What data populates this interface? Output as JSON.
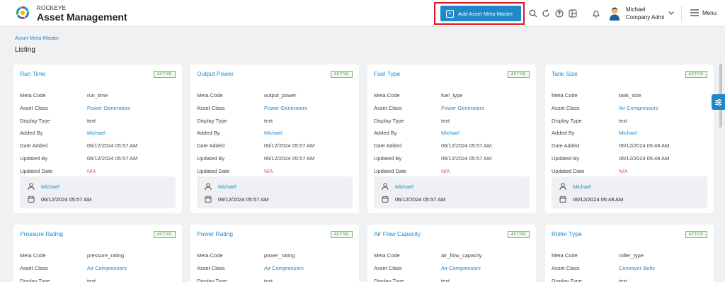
{
  "header": {
    "brand_small": "ROCKEYE",
    "brand_big": "Asset Management",
    "add_button_label": "Add Asset Meta Master",
    "user_name": "Michael",
    "user_role": "Company Admi",
    "menu_label": "Menu"
  },
  "breadcrumb": "Asset Meta Master",
  "page_title": "Listing",
  "field_labels": {
    "meta_code": "Meta Code",
    "asset_class": "Asset Class",
    "display_type": "Display Type",
    "added_by": "Added By",
    "date_added": "Date Added",
    "updated_by": "Updated By",
    "updated_date": "Updated Date"
  },
  "cards": [
    {
      "title": "Run Time",
      "status": "ACTIVE",
      "meta_code": "run_time",
      "asset_class": "Power Generators",
      "display_type": "text",
      "added_by": "Michael",
      "date_added": "06/12/2024 05:57 AM",
      "updated_by": "06/12/2024 05:57 AM",
      "updated_date": "N/A",
      "footer_name": "Michael",
      "footer_date": "06/12/2024 05:57 AM"
    },
    {
      "title": "Output Power",
      "status": "ACTIVE",
      "meta_code": "output_power",
      "asset_class": "Power Generators",
      "display_type": "text",
      "added_by": "Michael",
      "date_added": "06/12/2024 05:57 AM",
      "updated_by": "06/12/2024 05:57 AM",
      "updated_date": "N/A",
      "footer_name": "Michael",
      "footer_date": "06/12/2024 05:57 AM"
    },
    {
      "title": "Fuel Type",
      "status": "ACTIVE",
      "meta_code": "fuel_type",
      "asset_class": "Power Generators",
      "display_type": "text",
      "added_by": "Michael",
      "date_added": "06/12/2024 05:57 AM",
      "updated_by": "06/12/2024 05:57 AM",
      "updated_date": "N/A",
      "footer_name": "Michael",
      "footer_date": "06/12/2024 05:57 AM"
    },
    {
      "title": "Tank Size",
      "status": "ACTIVE",
      "meta_code": "tank_size",
      "asset_class": "Air Compressors",
      "display_type": "text",
      "added_by": "Michael",
      "date_added": "06/12/2024 05:48 AM",
      "updated_by": "06/12/2024 05:48 AM",
      "updated_date": "N/A",
      "footer_name": "Michael",
      "footer_date": "06/12/2024 05:48 AM"
    },
    {
      "title": "Pressure Rating",
      "status": "ACTIVE",
      "meta_code": "pressure_rating",
      "asset_class": "Air Compressors",
      "display_type": "text"
    },
    {
      "title": "Power Rating",
      "status": "ACTIVE",
      "meta_code": "power_rating",
      "asset_class": "Air Compressors",
      "display_type": "text"
    },
    {
      "title": "Air Flow Capacity",
      "status": "ACTIVE",
      "meta_code": "air_flow_capacity",
      "asset_class": "Air Compressors",
      "display_type": "text"
    },
    {
      "title": "Roller Type",
      "status": "ACTIVE",
      "meta_code": "roller_type",
      "asset_class": "Conveyor Belts",
      "display_type": "text"
    }
  ],
  "colors": {
    "accent": "#1e88c9",
    "highlight_border": "#e0141e",
    "active_badge": "#3f9a3a",
    "na": "#e05757"
  },
  "icons": [
    "rockeye-logo-icon",
    "plus-icon",
    "search-icon",
    "refresh-icon",
    "upload-icon",
    "layout-icon",
    "bell-icon",
    "user-avatar-icon",
    "chevron-down-icon",
    "hamburger-icon",
    "user-icon",
    "calendar-icon",
    "filter-icon"
  ]
}
